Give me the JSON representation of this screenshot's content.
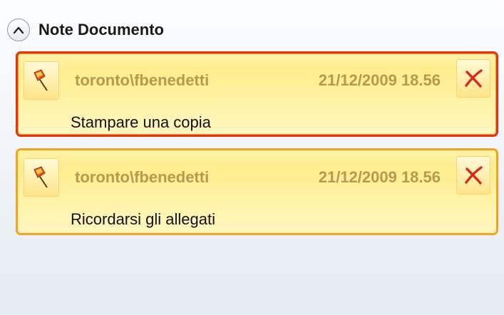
{
  "section": {
    "title": "Note Documento",
    "collapse_icon": "chevron-up-icon"
  },
  "notes": [
    {
      "author": "toronto\\fbenedetti",
      "datetime": "21/12/2009 18.56",
      "text": "Stampare una copia",
      "state": "selected",
      "pin_icon": "pushpin-icon",
      "delete_icon": "close-icon"
    },
    {
      "author": "toronto\\fbenedetti",
      "datetime": "21/12/2009 18.56",
      "text": "Ricordarsi gli allegati",
      "state": "normal",
      "pin_icon": "pushpin-icon",
      "delete_icon": "close-icon"
    }
  ],
  "colors": {
    "selected_border": "#e8330f",
    "normal_border": "#f3a322",
    "note_fill": "#ffed8c",
    "header_text": "#b59a4e",
    "delete_icon": "#d9291b"
  }
}
